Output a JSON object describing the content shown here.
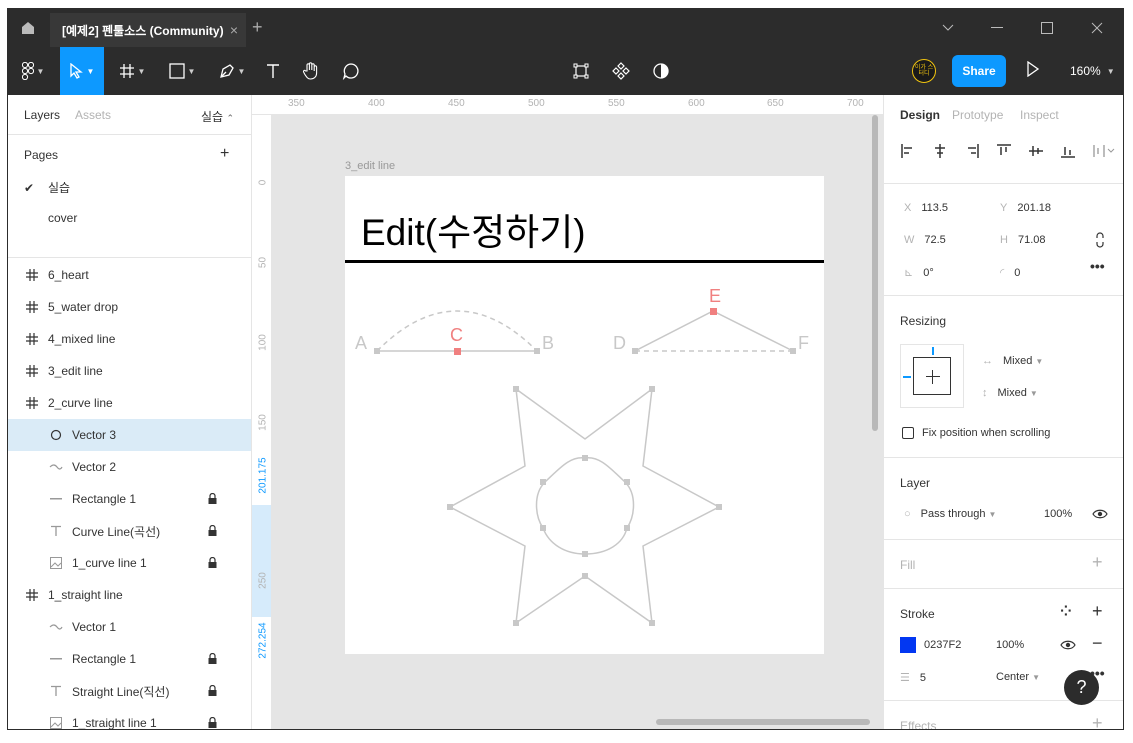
{
  "window": {
    "tab_title": "[예제2] 펜툴소스 (Community)",
    "tab_close": "×",
    "new_tab": "+"
  },
  "toolbar": {
    "zoom": "160%",
    "share_label": "Share",
    "avatar_text": "이가 스터디"
  },
  "left_panel": {
    "tabs": [
      "Layers",
      "Assets"
    ],
    "page_switcher": "실습",
    "pages_heading": "Pages",
    "pages": [
      {
        "name": "실습",
        "checked": true
      },
      {
        "name": "cover",
        "checked": false
      }
    ],
    "layers": [
      {
        "name": "6_heart",
        "icon": "frame-icon",
        "indent": 0,
        "locked": false,
        "selected": false
      },
      {
        "name": "5_water drop",
        "icon": "frame-icon",
        "indent": 0,
        "locked": false,
        "selected": false
      },
      {
        "name": "4_mixed line",
        "icon": "frame-icon",
        "indent": 0,
        "locked": false,
        "selected": false
      },
      {
        "name": "3_edit line",
        "icon": "frame-icon",
        "indent": 0,
        "locked": false,
        "selected": false
      },
      {
        "name": "2_curve line",
        "icon": "frame-icon",
        "indent": 0,
        "locked": false,
        "selected": false
      },
      {
        "name": "Vector 3",
        "icon": "ellipse-icon",
        "indent": 1,
        "locked": false,
        "selected": true
      },
      {
        "name": "Vector 2",
        "icon": "vector-icon",
        "indent": 1,
        "locked": false,
        "selected": false
      },
      {
        "name": "Rectangle 1",
        "icon": "line-icon",
        "indent": 1,
        "locked": true,
        "selected": false
      },
      {
        "name": "Curve Line(곡선)",
        "icon": "text-icon",
        "indent": 1,
        "locked": true,
        "selected": false
      },
      {
        "name": "1_curve line 1",
        "icon": "image-icon",
        "indent": 1,
        "locked": true,
        "selected": false
      },
      {
        "name": "1_straight line",
        "icon": "frame-icon",
        "indent": 0,
        "locked": false,
        "selected": false
      },
      {
        "name": "Vector 1",
        "icon": "vector-icon",
        "indent": 1,
        "locked": false,
        "selected": false
      },
      {
        "name": "Rectangle 1",
        "icon": "line-icon",
        "indent": 1,
        "locked": true,
        "selected": false
      },
      {
        "name": "Straight Line(직선)",
        "icon": "text-icon",
        "indent": 1,
        "locked": true,
        "selected": false
      },
      {
        "name": "1_straight line 1",
        "icon": "image-icon",
        "indent": 1,
        "locked": true,
        "selected": false
      }
    ]
  },
  "canvas": {
    "ruler_top": [
      "350",
      "400",
      "450",
      "500",
      "550",
      "600",
      "650",
      "700"
    ],
    "ruler_left": [
      "0",
      "50",
      "100",
      "150",
      "201.175",
      "250",
      "272.254",
      "0"
    ],
    "frame_label": "3_edit line",
    "frame_title": "Edit(수정하기)",
    "point_labels": {
      "A": "A",
      "B": "B",
      "C": "C",
      "D": "D",
      "E": "E",
      "F": "F"
    }
  },
  "right_panel": {
    "tabs": [
      "Design",
      "Prototype",
      "Inspect"
    ],
    "x_label": "X",
    "x": "113.5",
    "y_label": "Y",
    "y": "201.18",
    "w_label": "W",
    "w": "72.5",
    "h_label": "H",
    "h": "71.08",
    "rotation": "0°",
    "radius": "0",
    "resizing_heading": "Resizing",
    "resize_h": "Mixed",
    "resize_v": "Mixed",
    "fix_position": "Fix position when scrolling",
    "layer_heading": "Layer",
    "blend_mode": "Pass through",
    "layer_opacity": "100%",
    "fill_heading": "Fill",
    "stroke_heading": "Stroke",
    "stroke_color": "0237F2",
    "stroke_color_hex": "#0237F2",
    "stroke_opacity": "100%",
    "stroke_weight": "5",
    "stroke_align": "Center",
    "effects_heading": "Effects"
  },
  "help": "?"
}
